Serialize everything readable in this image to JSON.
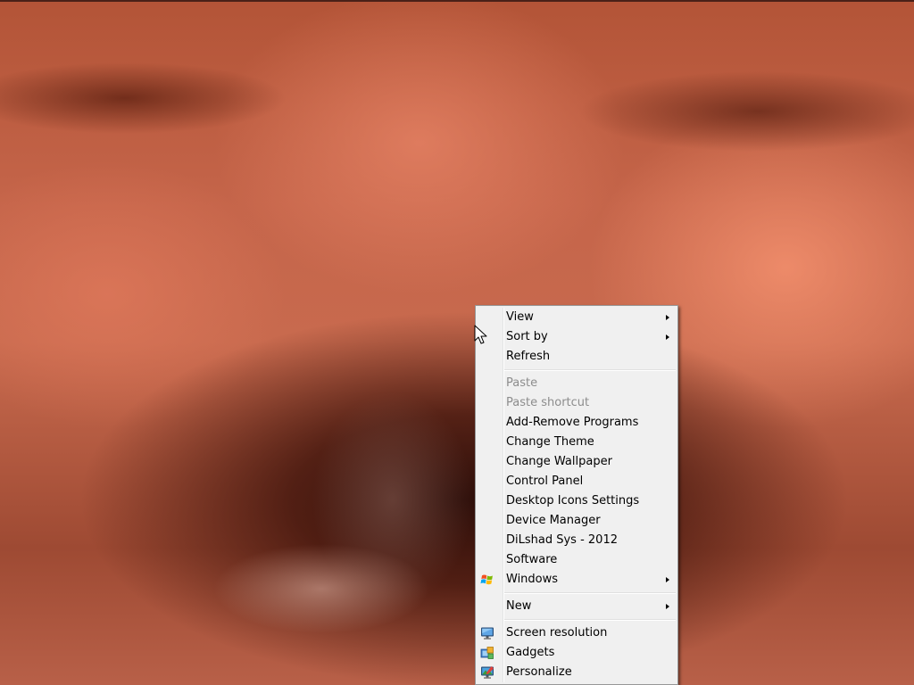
{
  "context_menu": {
    "groups": [
      [
        {
          "label": "View",
          "submenu": true,
          "disabled": false
        },
        {
          "label": "Sort by",
          "submenu": true,
          "disabled": false
        },
        {
          "label": "Refresh",
          "submenu": false,
          "disabled": false
        }
      ],
      [
        {
          "label": "Paste",
          "submenu": false,
          "disabled": true
        },
        {
          "label": "Paste shortcut",
          "submenu": false,
          "disabled": true
        },
        {
          "label": "Add-Remove Programs",
          "submenu": false,
          "disabled": false
        },
        {
          "label": "Change Theme",
          "submenu": false,
          "disabled": false
        },
        {
          "label": "Change Wallpaper",
          "submenu": false,
          "disabled": false
        },
        {
          "label": "Control Panel",
          "submenu": false,
          "disabled": false
        },
        {
          "label": "Desktop Icons Settings",
          "submenu": false,
          "disabled": false
        },
        {
          "label": "Device Manager",
          "submenu": false,
          "disabled": false
        },
        {
          "label": "DiLshad Sys - 2012",
          "submenu": false,
          "disabled": false
        },
        {
          "label": "Software",
          "submenu": false,
          "disabled": false
        },
        {
          "label": "Windows",
          "submenu": true,
          "disabled": false,
          "icon": "windows-logo-icon"
        }
      ],
      [
        {
          "label": "New",
          "submenu": true,
          "disabled": false
        }
      ],
      [
        {
          "label": "Screen resolution",
          "submenu": false,
          "disabled": false,
          "icon": "screen-resolution-icon"
        },
        {
          "label": "Gadgets",
          "submenu": false,
          "disabled": false,
          "icon": "gadgets-icon"
        },
        {
          "label": "Personalize",
          "submenu": false,
          "disabled": false,
          "icon": "personalize-icon"
        }
      ]
    ]
  },
  "colors": {
    "menu_background": "#f0f0f0",
    "menu_border": "#979797",
    "disabled_text": "#8d8d8d"
  }
}
